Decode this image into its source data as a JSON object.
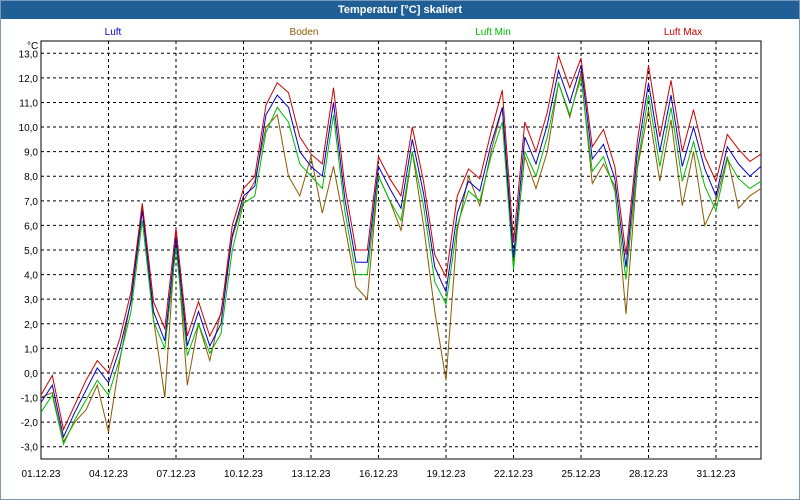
{
  "window": {
    "title": "Temperatur [°C] skaliert"
  },
  "chart_data": {
    "type": "line",
    "title": "Temperatur [°C] skaliert",
    "ylabel": "°C",
    "xlabel": "",
    "ylim": [
      -3.5,
      13.5
    ],
    "xlim": [
      "2023-12-01",
      "2024-01-02"
    ],
    "y_ticks": [
      "-3,0",
      "-2,0",
      "-1,0",
      "0,0",
      "1,0",
      "2,0",
      "3,0",
      "4,0",
      "5,0",
      "6,0",
      "7,0",
      "8,0",
      "9,0",
      "10,0",
      "11,0",
      "12,0",
      "13,0"
    ],
    "x_ticks": [
      "01.12.23",
      "04.12.23",
      "07.12.23",
      "10.12.23",
      "13.12.23",
      "16.12.23",
      "19.12.23",
      "22.12.23",
      "25.12.23",
      "28.12.23",
      "31.12.23"
    ],
    "grid": true,
    "legend_position": "top",
    "x": [
      "2023-12-01",
      "2023-12-01 12:00",
      "2023-12-02",
      "2023-12-02 12:00",
      "2023-12-03",
      "2023-12-03 12:00",
      "2023-12-04",
      "2023-12-04 12:00",
      "2023-12-05",
      "2023-12-05 12:00",
      "2023-12-06",
      "2023-12-06 12:00",
      "2023-12-07",
      "2023-12-07 12:00",
      "2023-12-08",
      "2023-12-08 12:00",
      "2023-12-09",
      "2023-12-09 12:00",
      "2023-12-10",
      "2023-12-10 12:00",
      "2023-12-11",
      "2023-12-11 12:00",
      "2023-12-12",
      "2023-12-12 12:00",
      "2023-12-13",
      "2023-12-13 12:00",
      "2023-12-14",
      "2023-12-14 12:00",
      "2023-12-15",
      "2023-12-15 12:00",
      "2023-12-16",
      "2023-12-16 12:00",
      "2023-12-17",
      "2023-12-17 12:00",
      "2023-12-18",
      "2023-12-18 12:00",
      "2023-12-19",
      "2023-12-19 12:00",
      "2023-12-20",
      "2023-12-20 12:00",
      "2023-12-21",
      "2023-12-21 12:00",
      "2023-12-22",
      "2023-12-22 12:00",
      "2023-12-23",
      "2023-12-23 12:00",
      "2023-12-24",
      "2023-12-24 12:00",
      "2023-12-25",
      "2023-12-25 12:00",
      "2023-12-26",
      "2023-12-26 12:00",
      "2023-12-27",
      "2023-12-27 12:00",
      "2023-12-28",
      "2023-12-28 12:00",
      "2023-12-29",
      "2023-12-29 12:00",
      "2023-12-30",
      "2023-12-30 12:00",
      "2023-12-31",
      "2023-12-31 12:00",
      "2024-01-01",
      "2024-01-01 12:00",
      "2024-01-02"
    ],
    "series": [
      {
        "name": "Luft",
        "color": "#0000cc",
        "values": [
          -1.2,
          -0.5,
          -2.6,
          -1.6,
          -0.7,
          0.2,
          -0.4,
          1.0,
          2.9,
          6.6,
          2.5,
          1.3,
          5.5,
          1.1,
          2.5,
          1.1,
          2.0,
          5.6,
          7.2,
          7.6,
          10.5,
          11.3,
          10.8,
          9.0,
          8.4,
          8.0,
          11.0,
          7.1,
          4.5,
          4.5,
          8.4,
          7.5,
          6.7,
          9.5,
          7.3,
          4.3,
          3.3,
          6.5,
          7.8,
          7.4,
          9.3,
          10.8,
          4.7,
          9.6,
          8.5,
          10.1,
          12.3,
          11.0,
          12.5,
          8.7,
          9.3,
          7.9,
          4.3,
          8.9,
          11.8,
          9.0,
          11.3,
          8.4,
          10.0,
          8.3,
          7.2,
          9.2,
          8.5,
          8.0,
          8.4
        ]
      },
      {
        "name": "Boden",
        "color": "#8b5a00",
        "values": [
          -1.0,
          -0.8,
          -2.8,
          -2.0,
          -1.5,
          -0.5,
          -2.4,
          0.5,
          3.0,
          6.8,
          2.2,
          -1.0,
          5.7,
          -0.5,
          2.0,
          0.5,
          2.5,
          5.5,
          7.0,
          7.8,
          10.0,
          10.5,
          8.0,
          7.2,
          8.8,
          6.5,
          8.4,
          6.0,
          3.5,
          3.0,
          8.0,
          7.0,
          5.8,
          9.0,
          6.0,
          2.5,
          -0.3,
          5.8,
          8.0,
          6.8,
          9.0,
          10.8,
          4.5,
          8.8,
          7.5,
          9.0,
          11.8,
          10.4,
          12.2,
          7.7,
          8.5,
          7.6,
          2.4,
          8.3,
          10.7,
          7.8,
          10.3,
          6.8,
          9.0,
          6.0,
          7.0,
          8.8,
          6.7,
          7.2,
          7.5
        ]
      },
      {
        "name": "Luft Min",
        "color": "#00bb00",
        "values": [
          -1.6,
          -0.9,
          -2.9,
          -1.9,
          -1.1,
          -0.3,
          -0.9,
          0.6,
          2.5,
          6.2,
          2.1,
          1.0,
          5.1,
          0.7,
          2.0,
          0.8,
          1.6,
          5.0,
          6.9,
          7.2,
          9.8,
          10.8,
          10.2,
          8.5,
          8.0,
          7.5,
          10.5,
          6.6,
          4.0,
          4.0,
          8.0,
          7.0,
          6.2,
          9.0,
          6.8,
          3.7,
          2.8,
          6.0,
          7.4,
          7.0,
          8.8,
          10.2,
          4.2,
          9.0,
          8.0,
          9.6,
          11.8,
          10.5,
          12.0,
          8.2,
          8.8,
          7.4,
          3.8,
          8.4,
          11.3,
          8.4,
          10.8,
          7.8,
          9.4,
          7.6,
          6.6,
          8.7,
          7.9,
          7.5,
          7.8
        ]
      },
      {
        "name": "Luft Max",
        "color": "#cc0000",
        "values": [
          -0.9,
          -0.1,
          -2.3,
          -1.3,
          -0.3,
          0.5,
          0.0,
          1.4,
          3.3,
          6.9,
          2.9,
          1.8,
          5.9,
          1.5,
          2.9,
          1.5,
          2.4,
          6.0,
          7.5,
          8.0,
          10.9,
          11.8,
          11.4,
          9.6,
          8.9,
          8.5,
          11.6,
          7.6,
          5.0,
          5.0,
          8.8,
          7.9,
          7.2,
          10.0,
          7.8,
          4.8,
          3.9,
          7.2,
          8.3,
          7.9,
          9.8,
          11.5,
          5.3,
          10.2,
          9.0,
          10.6,
          12.9,
          11.6,
          12.8,
          9.2,
          9.9,
          8.4,
          4.8,
          9.4,
          12.5,
          9.6,
          11.9,
          9.0,
          10.7,
          8.8,
          7.8,
          9.7,
          9.1,
          8.6,
          8.9
        ]
      }
    ]
  }
}
